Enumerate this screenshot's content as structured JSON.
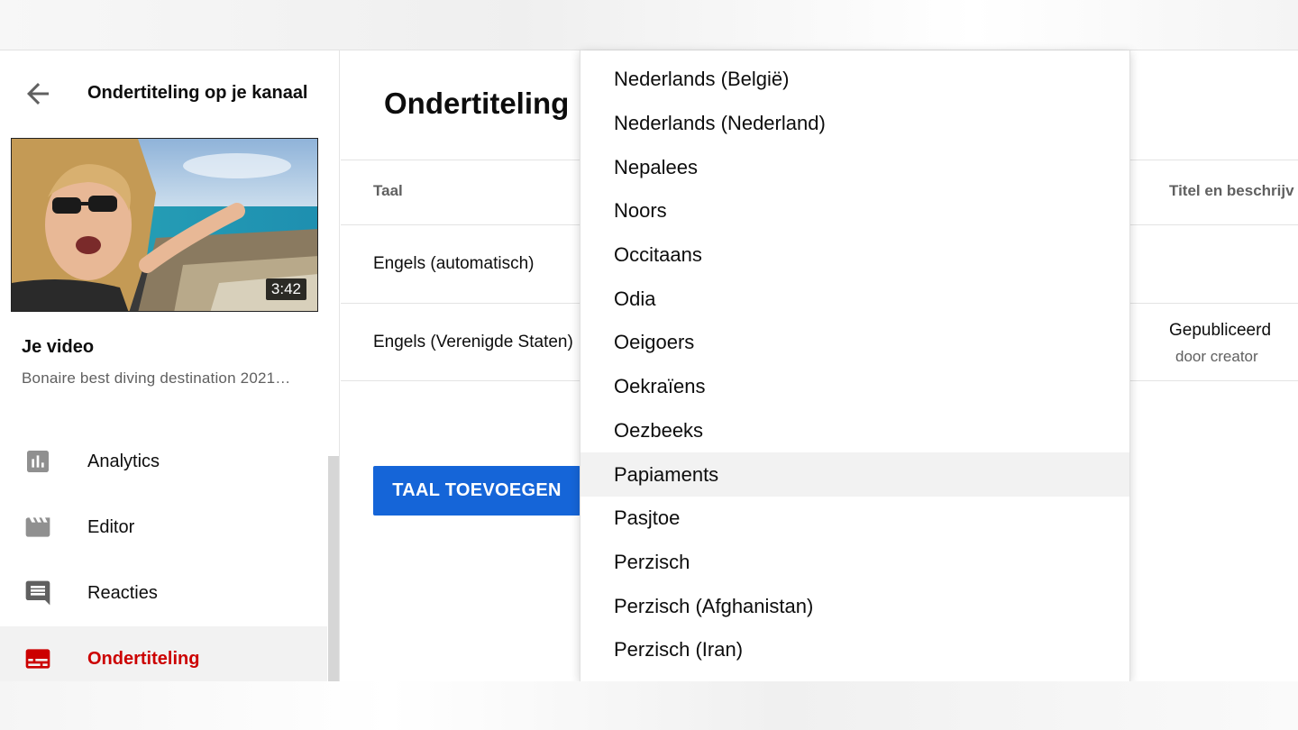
{
  "sidebar": {
    "title": "Ondertiteling op je kanaal",
    "video": {
      "duration": "3:42",
      "label": "Je video",
      "name": "Bonaire best diving destination 2021…"
    },
    "nav": [
      {
        "label": "Analytics",
        "icon": "analytics-icon"
      },
      {
        "label": "Editor",
        "icon": "editor-icon"
      },
      {
        "label": "Reacties",
        "icon": "comments-icon"
      },
      {
        "label": "Ondertiteling",
        "icon": "subtitles-icon",
        "active": true
      }
    ]
  },
  "main": {
    "title": "Ondertiteling",
    "columns": {
      "language": "Taal",
      "title_desc": "Titel en beschrijv"
    },
    "rows": [
      {
        "language": "Engels (automatisch)"
      },
      {
        "language": "Engels (Verenigde Staten)",
        "status": "Gepubliceerd",
        "status_sub": "door creator"
      }
    ],
    "add_button": "TAAL TOEVOEGEN"
  },
  "dropdown": {
    "items": [
      "Nederlands (België)",
      "Nederlands (Nederland)",
      "Nepalees",
      "Noors",
      "Occitaans",
      "Odia",
      "Oeigoers",
      "Oekraïens",
      "Oezbeeks",
      "Papiaments",
      "Pasjtoe",
      "Perzisch",
      "Perzisch (Afghanistan)",
      "Perzisch (Iran)"
    ],
    "highlighted": "Papiaments"
  },
  "colors": {
    "accent_red": "#cc0000",
    "button_blue": "#1565d8",
    "highlight": "#f2f2f2"
  }
}
